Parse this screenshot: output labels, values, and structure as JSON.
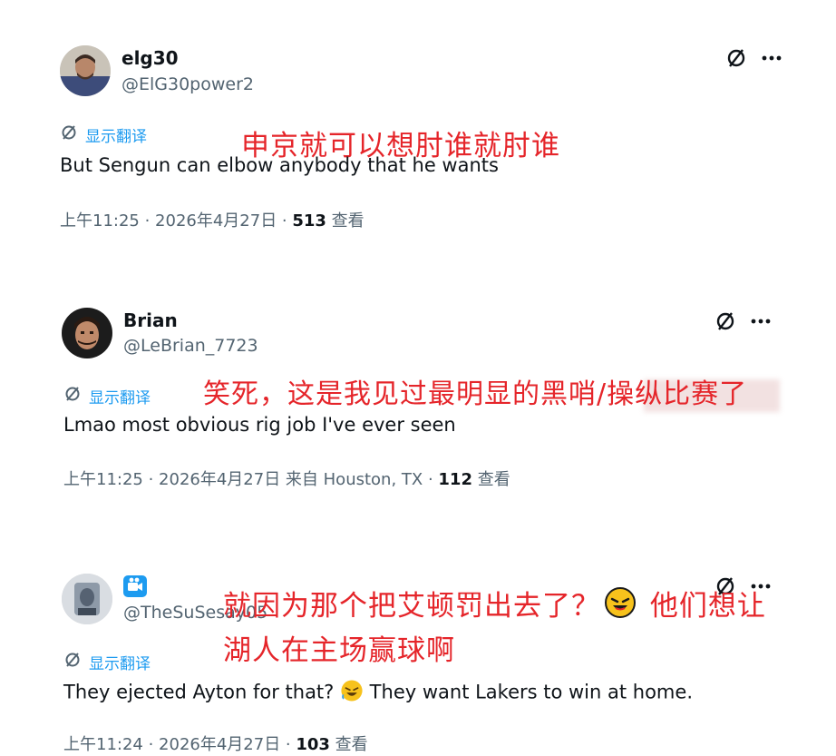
{
  "posts": [
    {
      "name": "elg30",
      "handle": "@ElG30power2",
      "translate_label": "显示翻译",
      "text": "But Sengun can elbow anybody that he wants",
      "time": "上午11:25 · 2026年4月27日 · ",
      "views": "513",
      "views_label": " 查看",
      "overlay_lines": [
        "申京就可以想肘谁就肘谁"
      ]
    },
    {
      "name": "Brian",
      "handle": "@LeBrian_7723",
      "translate_label": "显示翻译",
      "text": "Lmao most obvious rig job I've ever seen",
      "time": "上午11:25 · 2026年4月27日 来自 Houston, TX · ",
      "views": "112",
      "views_label": " 查看",
      "overlay_lines": [
        "笑死，这是我见过最明显的黑哨/操纵比赛了"
      ]
    },
    {
      "name": "",
      "handle": "@TheSuSesay05",
      "translate_label": "显示翻译",
      "text_before": "They ejected Ayton for that? ",
      "text_after": " They want Lakers to win at home.",
      "time": "上午11:24 · 2026年4月27日 · ",
      "views": "103",
      "views_label": " 查看",
      "overlay_line1_before": "就因为那个把艾顿罚出去了？",
      "overlay_line1_after": " 他们想让",
      "overlay_line2": "湖人在主场赢球啊"
    }
  ],
  "icons": {
    "action_icon": "slashed-circle-icon",
    "more_icon": "more-dots-icon",
    "translate_icon": "translate-slashed-circle-icon",
    "emoji": "rolling-laughing-emoji",
    "verified_icon": "camera-badge-icon"
  },
  "colors": {
    "accent": "#1d9bf0",
    "overlay": "#e5252a",
    "muted": "#536471"
  }
}
